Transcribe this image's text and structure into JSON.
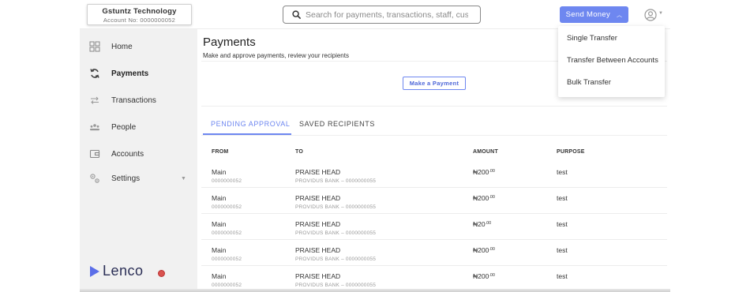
{
  "account": {
    "name": "Gstuntz Technology",
    "number": "Account No: 0000000052"
  },
  "search": {
    "placeholder": "Search for payments, transactions, staff, customers"
  },
  "send_money": {
    "label": "Send Money"
  },
  "dropdown": {
    "items": [
      {
        "label": "Single Transfer"
      },
      {
        "label": "Transfer Between Accounts"
      },
      {
        "label": "Bulk Transfer"
      }
    ]
  },
  "sidebar": {
    "items": [
      {
        "label": "Home",
        "icon": "grid-icon"
      },
      {
        "label": "Payments",
        "icon": "sync-icon",
        "active": true
      },
      {
        "label": "Transactions",
        "icon": "arrows-icon"
      },
      {
        "label": "People",
        "icon": "people-icon"
      },
      {
        "label": "Accounts",
        "icon": "wallet-icon"
      },
      {
        "label": "Settings",
        "icon": "gear-icon"
      }
    ],
    "logo": "Lenco"
  },
  "page": {
    "title": "Payments",
    "subtitle": "Make and approve payments, review your recipients",
    "make_payment": "Make a Payment"
  },
  "tabs": [
    {
      "label": "PENDING APPROVAL",
      "active": true
    },
    {
      "label": "SAVED RECIPIENTS",
      "active": false
    }
  ],
  "table": {
    "headers": {
      "from": "FROM",
      "to": "TO",
      "amount": "AMOUNT",
      "purpose": "PURPOSE"
    },
    "rows": [
      {
        "from": "Main",
        "from_acct": "0000000052",
        "to": "PRAISE HEAD",
        "to_bank": "PROVIDUS BANK – 0000000055",
        "amount_main": "₦200",
        "amount_dec": ".00",
        "purpose": "test"
      },
      {
        "from": "Main",
        "from_acct": "0000000052",
        "to": "PRAISE HEAD",
        "to_bank": "PROVIDUS BANK – 0000000055",
        "amount_main": "₦200",
        "amount_dec": ".00",
        "purpose": "test"
      },
      {
        "from": "Main",
        "from_acct": "0000000052",
        "to": "PRAISE HEAD",
        "to_bank": "PROVIDUS BANK – 0000000055",
        "amount_main": "₦20",
        "amount_dec": ".00",
        "purpose": "test"
      },
      {
        "from": "Main",
        "from_acct": "0000000052",
        "to": "PRAISE HEAD",
        "to_bank": "PROVIDUS BANK – 0000000055",
        "amount_main": "₦200",
        "amount_dec": ".00",
        "purpose": "test"
      },
      {
        "from": "Main",
        "from_acct": "0000000052",
        "to": "PRAISE HEAD",
        "to_bank": "PROVIDUS BANK – 0000000055",
        "amount_main": "₦200",
        "amount_dec": ".00",
        "purpose": "test"
      }
    ]
  },
  "colors": {
    "accent": "#6e87f0",
    "sidebar_bg": "#f1f1f1",
    "logo": "#2b2f56",
    "badge": "#d9534f"
  }
}
